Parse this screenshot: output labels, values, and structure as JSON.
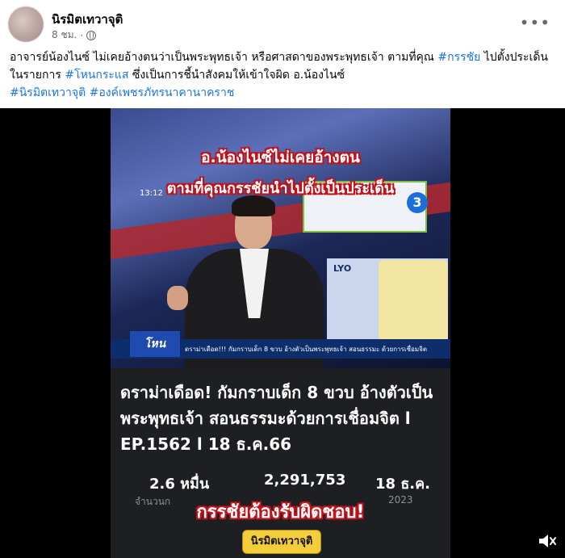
{
  "post": {
    "author": "นิรมิตเทวาจุติ",
    "time": "8 ชม.",
    "more_icon": "more-horizontal-icon",
    "privacy_icon": "globe-icon",
    "caption": {
      "part1": "อาจารย์น้องไนซ์ ไม่เคยอ้างตนว่าเป็นพระพุทธเจ้า หรือศาสดาของพระพุทธเจ้า ตามที่คุณ ",
      "tag1": "#กรรชัย",
      "part2": " ไปตั้งประเด็น ในรายการ ",
      "tag2": "#โหนกระแส",
      "part3": " ซึ่งเป็นการชี้นำสังคมให้เข้าใจผิด อ.น้องไนซ์",
      "tag3": "#นิรมิตเทวาจุติ",
      "tag4": "#องค์เพชรภัทรนาคานาคราช"
    }
  },
  "video": {
    "banner_line1": "อ.น้องไนซ์ไม่เคยอ้างตน",
    "banner_line2": "ตามที่คุณกรรชัยนำไปตั้งเป็นประเด็น",
    "timecode": "13:12",
    "channel_badge": "3",
    "product_label": "LYO",
    "show_logo": "โหน",
    "ticker": "ดราม่าเดือด!!! กัมกราบเด็ก 8 ขวบ อ้างตัวเป็นพระพุทธเจ้า สอนธรรมะ ด้วยการเชื่อมจิต",
    "title": "ดราม่าเดือด! กัมกราบเด็ก 8 ขวบ อ้างตัวเป็นพระพุทธเจ้า สอนธรรมะด้วยการเชื่อมจิต l EP.1562 l 18 ธ.ค.66",
    "stat_views": "2.6 หมื่น",
    "stat_count": "2,291,753",
    "stat_date": "18 ธ.ค.",
    "sub_label": "จำนวนก",
    "sub_year": "2023",
    "warning": "กรรชัยต้องรับผิดชอบ!",
    "watermark": "นิรมิตเทวาจุติ",
    "mute_icon": "speaker-muted-icon"
  }
}
